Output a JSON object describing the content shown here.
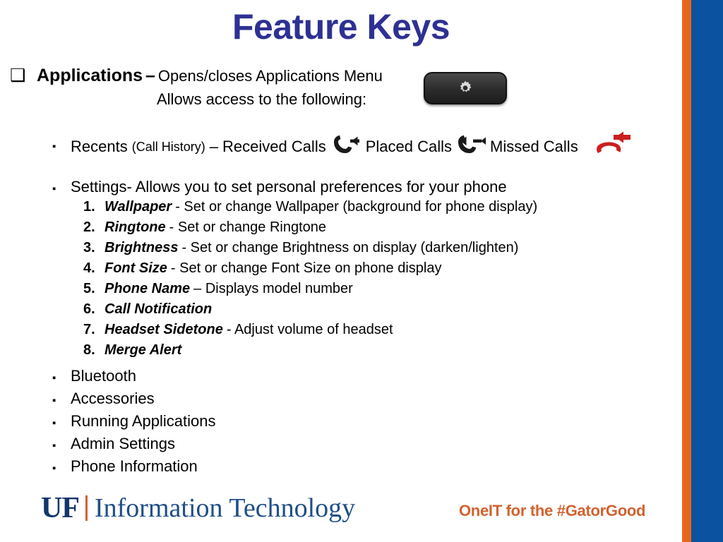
{
  "title": "Feature Keys",
  "colors": {
    "title": "#2E3192",
    "edge_orange": "#E8651C",
    "edge_blue": "#0B52A0",
    "footer_orange": "#D2622F",
    "uf_navy": "#11366B",
    "uf_blue": "#1F4E87",
    "missed_call_red": "#CC1F20"
  },
  "applications": {
    "bullet": "❑",
    "name": "Applications",
    "dash": "–",
    "description": "Opens/closes Applications Menu",
    "line2": "Allows access to the following:",
    "hard_key_icon": "gear-icon"
  },
  "recents": {
    "bullet": "▪",
    "label": "Recents",
    "paren": "(Call History)",
    "dash": "–",
    "received_label": "Received Calls",
    "received_icon": "received-call-icon",
    "placed_label": "Placed Calls",
    "placed_icon": "placed-call-icon",
    "missed_label": "Missed Calls",
    "missed_icon": "missed-call-icon"
  },
  "settings": {
    "bullet": "▪",
    "heading": "Settings- Allows you to set personal preferences for your phone",
    "items": [
      {
        "index": "1.",
        "term": "Wallpaper",
        "desc": "- Set or change Wallpaper (background for phone display)"
      },
      {
        "index": "2.",
        "term": "Ringtone",
        "desc": "- Set or change Ringtone"
      },
      {
        "index": "3.",
        "term": "Brightness",
        "desc": "- Set or change Brightness on display (darken/lighten)"
      },
      {
        "index": "4.",
        "term": "Font Size",
        "desc": "- Set or change Font Size on phone display"
      },
      {
        "index": "5.",
        "term": "Phone Name",
        "desc": "– Displays model number"
      },
      {
        "index": "6.",
        "term": "Call Notification",
        "desc": ""
      },
      {
        "index": "7.",
        "term": "Headset Sidetone",
        "desc": "- Adjust volume of headset"
      },
      {
        "index": "8.",
        "term": "Merge Alert",
        "desc": ""
      }
    ]
  },
  "other_menu_items": {
    "bullet": "▪",
    "items": [
      "Bluetooth",
      "Accessories",
      "Running Applications",
      "Admin Settings",
      "Phone Information"
    ]
  },
  "footer": {
    "uf_mark": "UF",
    "uf_words": "Information Technology",
    "tagline": "OneIT for the #GatorGood"
  }
}
